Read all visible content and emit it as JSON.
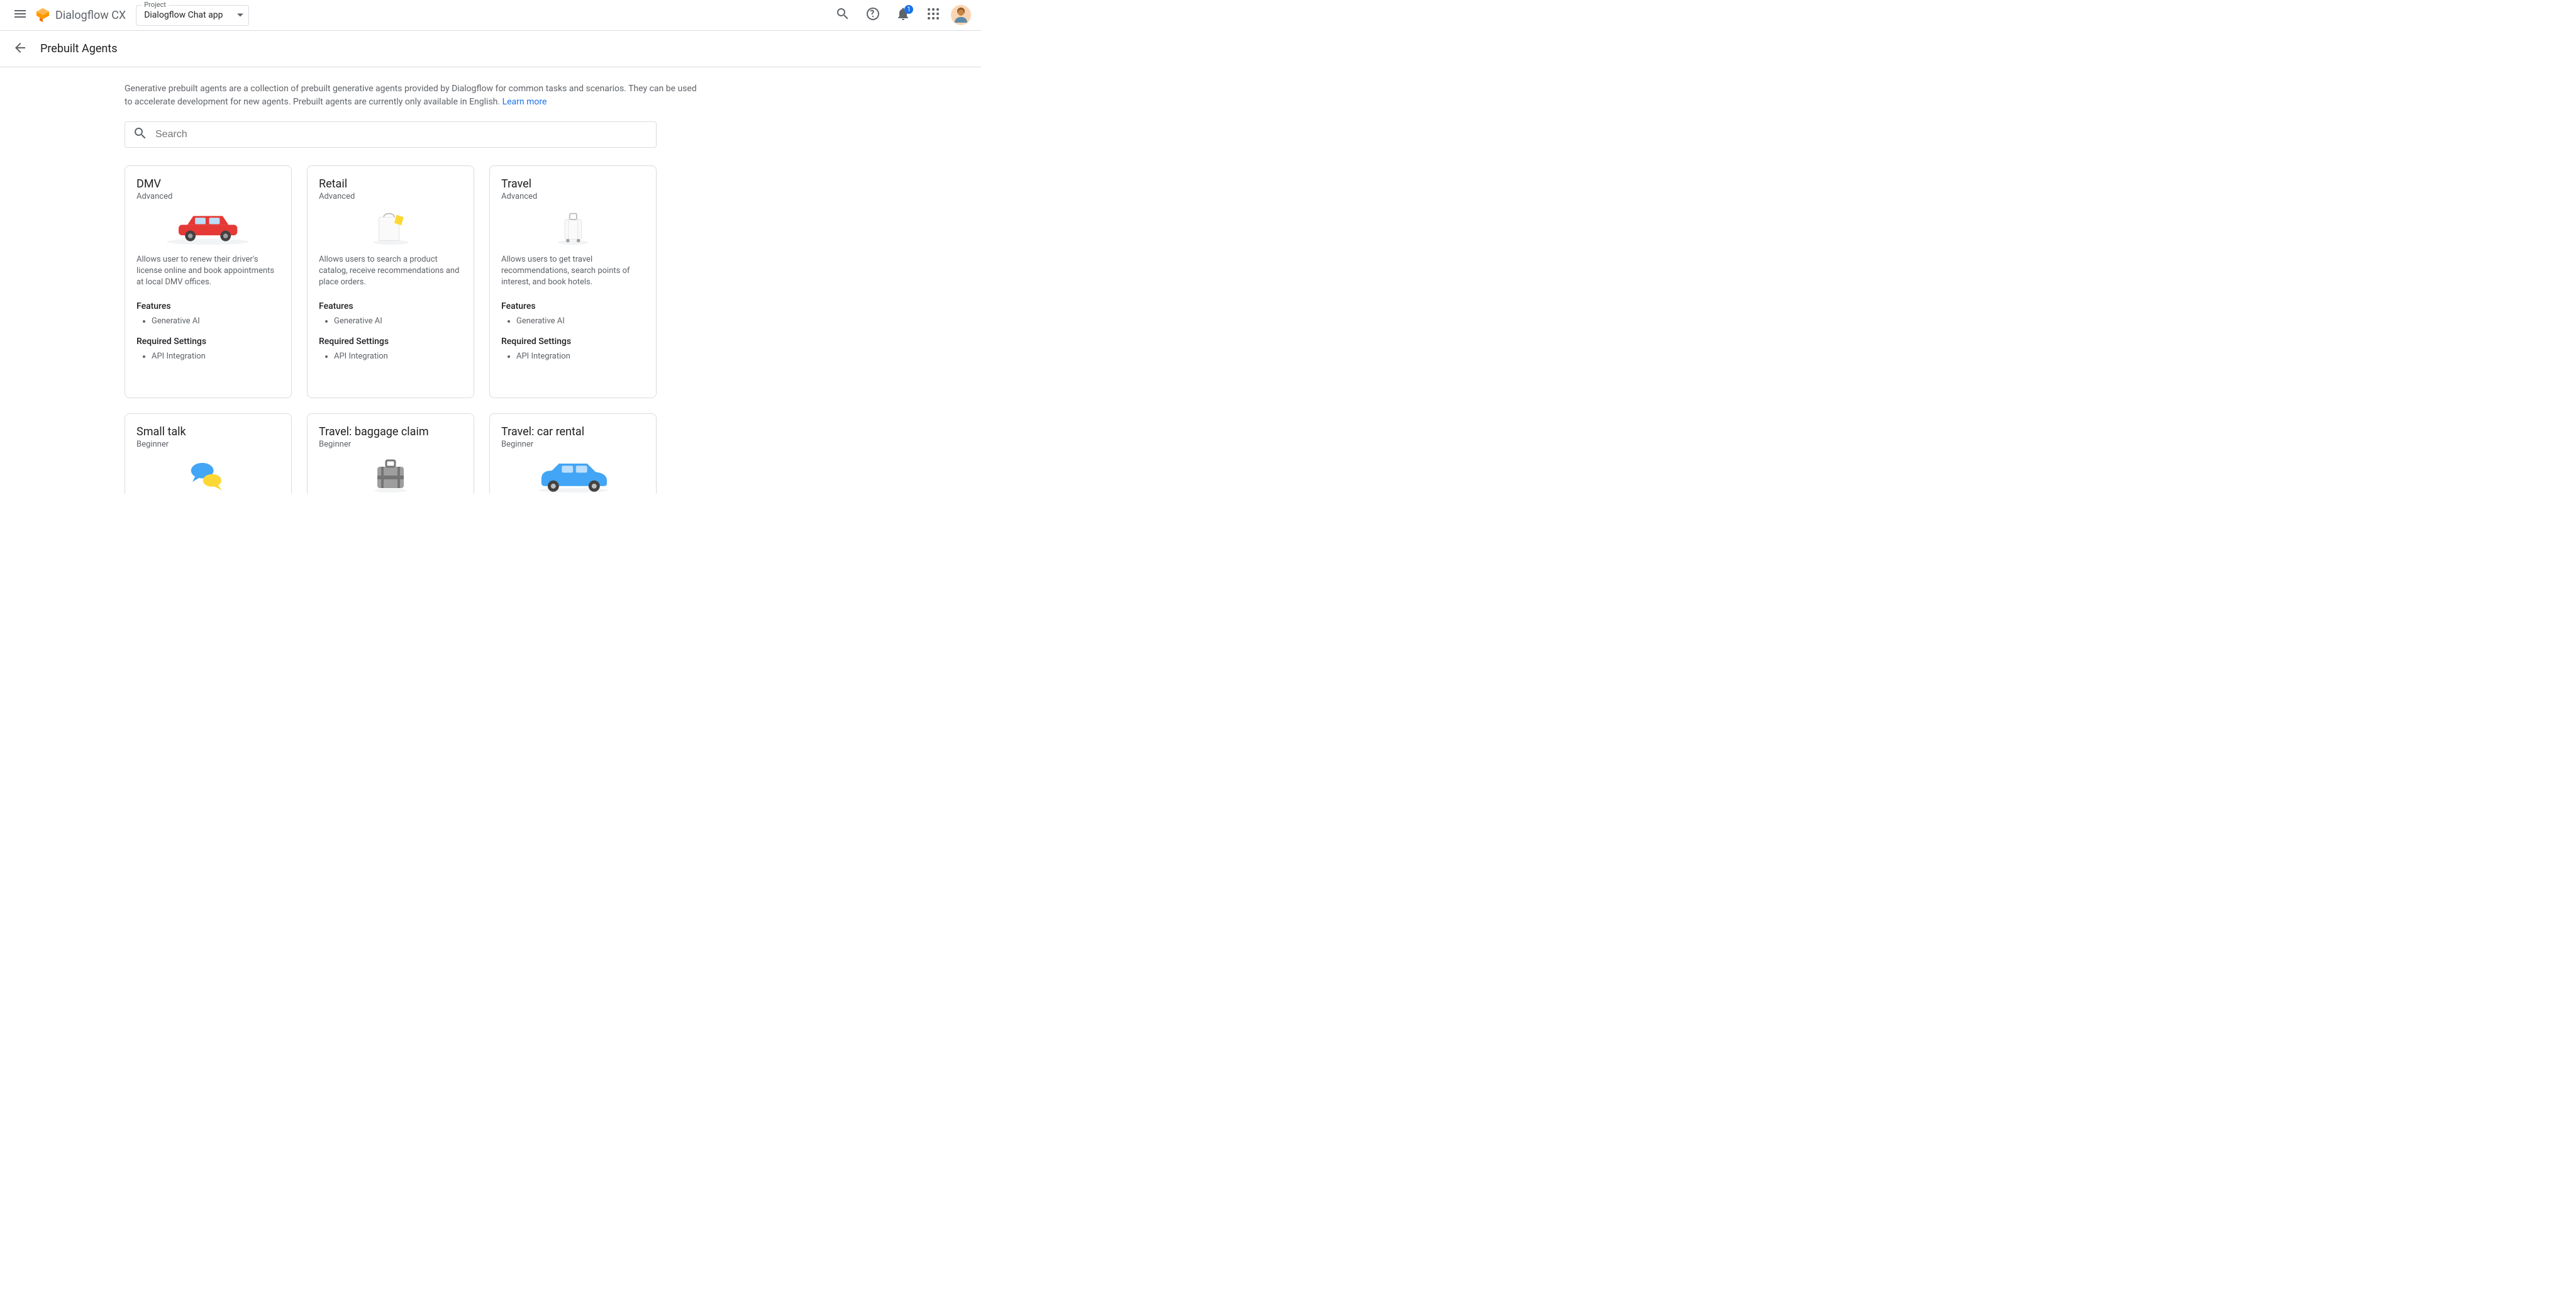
{
  "topbar": {
    "product_name": "Dialogflow CX",
    "project_label": "Project",
    "project_value": "Dialogflow Chat app",
    "notification_count": "1"
  },
  "subheader": {
    "page_title": "Prebuilt Agents"
  },
  "intro": {
    "text": "Generative prebuilt agents are a collection of prebuilt generative agents provided by Dialogflow for common tasks and scenarios. They can be used to accelerate development for new agents. Prebuilt agents are currently only available in English. ",
    "learn_more": "Learn more"
  },
  "search": {
    "placeholder": "Search"
  },
  "labels": {
    "features": "Features",
    "required_settings": "Required Settings"
  },
  "cards": [
    {
      "title": "DMV",
      "level": "Advanced",
      "desc": "Allows user to renew their driver's license online and book appointments at local DMV offices.",
      "features": [
        "Generative AI"
      ],
      "required": [
        "API Integration"
      ],
      "icon": "car-red"
    },
    {
      "title": "Retail",
      "level": "Advanced",
      "desc": "Allows users to search a product catalog, receive recommendations and place orders.",
      "features": [
        "Generative AI"
      ],
      "required": [
        "API Integration"
      ],
      "icon": "shopping-bag"
    },
    {
      "title": "Travel",
      "level": "Advanced",
      "desc": "Allows users to get travel recommendations, search points of interest, and book hotels.",
      "features": [
        "Generative AI"
      ],
      "required": [
        "API Integration"
      ],
      "icon": "suitcase"
    },
    {
      "title": "Small talk",
      "level": "Beginner",
      "desc": "",
      "features": [],
      "required": [],
      "icon": "chat-bubbles"
    },
    {
      "title": "Travel: baggage claim",
      "level": "Beginner",
      "desc": "",
      "features": [],
      "required": [],
      "icon": "luggage-grey"
    },
    {
      "title": "Travel: car rental",
      "level": "Beginner",
      "desc": "",
      "features": [],
      "required": [],
      "icon": "car-blue"
    }
  ]
}
